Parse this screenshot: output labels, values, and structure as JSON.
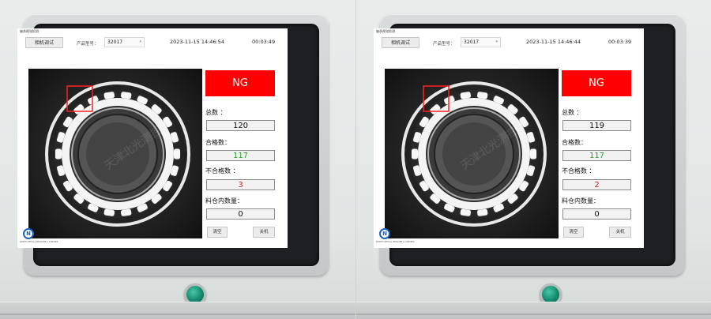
{
  "panels": [
    {
      "app_title": "轴承视觉检测",
      "camera_button": "相机调试",
      "product_label": "产品型号：",
      "product_value": "32017",
      "datetime": "2023-11-15 14:46:54",
      "elapsed": "00:03:49",
      "status": "NG",
      "total_label": "总数 ：",
      "total_value": "120",
      "pass_label": "合格数：",
      "pass_value": "117",
      "fail_label": "不合格数 ：",
      "fail_value": "3",
      "bin_label": "料仓内数量：",
      "bin_value": "0",
      "clear_button": "清空",
      "power_button": "关机",
      "watermark": "天津北光测控",
      "logo_text": "NORTH OPTICAL MEASURE & CONTROL"
    },
    {
      "app_title": "轴承视觉检测",
      "camera_button": "相机调试",
      "product_label": "产品型号：",
      "product_value": "32017",
      "datetime": "2023-11-15 14:46:44",
      "elapsed": "00:03:39",
      "status": "NG",
      "total_label": "总数 ：",
      "total_value": "119",
      "pass_label": "合格数：",
      "pass_value": "117",
      "fail_label": "不合格数 ：",
      "fail_value": "2",
      "bin_label": "料仓内数量：",
      "bin_value": "0",
      "clear_button": "清空",
      "power_button": "关机",
      "watermark": "天津北光测控",
      "logo_text": "NORTH OPTICAL MEASURE & CONTROL"
    }
  ],
  "colors": {
    "ng": "#ff0000",
    "pass_value": "#2a9a2a",
    "fail_value": "#e02020",
    "logo": "#1c62b9",
    "button_light": "#138a6e"
  },
  "icons": [
    "chevron-down-icon",
    "company-logo-icon",
    "green-push-button"
  ]
}
